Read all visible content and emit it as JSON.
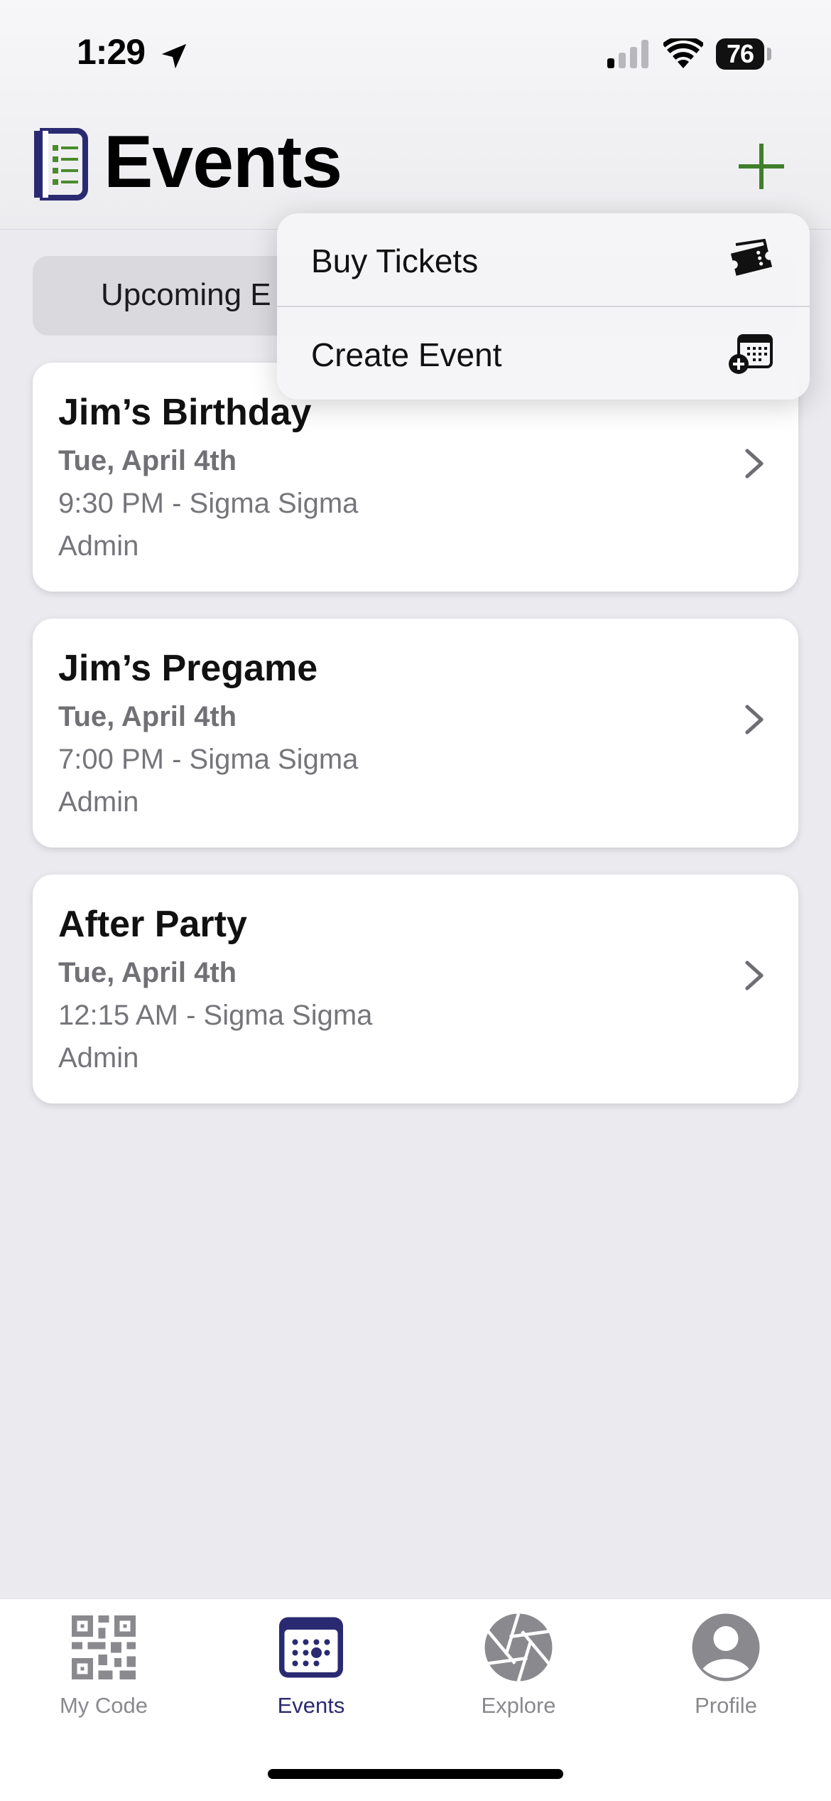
{
  "status": {
    "time": "1:29",
    "battery": "76"
  },
  "header": {
    "title": "Events"
  },
  "segment": {
    "left_label": "Upcoming E"
  },
  "menu": {
    "items": [
      {
        "label": "Buy Tickets",
        "icon": "ticket-icon"
      },
      {
        "label": "Create Event",
        "icon": "calendar-add-icon"
      }
    ]
  },
  "events": [
    {
      "title": "Jim’s Birthday",
      "date": "Tue, April 4th",
      "time": "9:30 PM - Sigma Sigma",
      "role": "Admin"
    },
    {
      "title": "Jim’s Pregame",
      "date": "Tue, April 4th",
      "time": "7:00 PM - Sigma Sigma",
      "role": "Admin"
    },
    {
      "title": "After Party",
      "date": "Tue, April 4th",
      "time": "12:15 AM - Sigma Sigma",
      "role": "Admin"
    }
  ],
  "tabs": [
    {
      "label": "My Code",
      "icon": "qr-code-icon"
    },
    {
      "label": "Events",
      "icon": "calendar-icon",
      "active": true
    },
    {
      "label": "Explore",
      "icon": "aperture-icon"
    },
    {
      "label": "Profile",
      "icon": "profile-icon"
    }
  ],
  "colors": {
    "accent": "#2a2a72",
    "plus": "#3f7f2a",
    "logo_green": "#4a8b2c",
    "muted": "#8a8a8e"
  }
}
